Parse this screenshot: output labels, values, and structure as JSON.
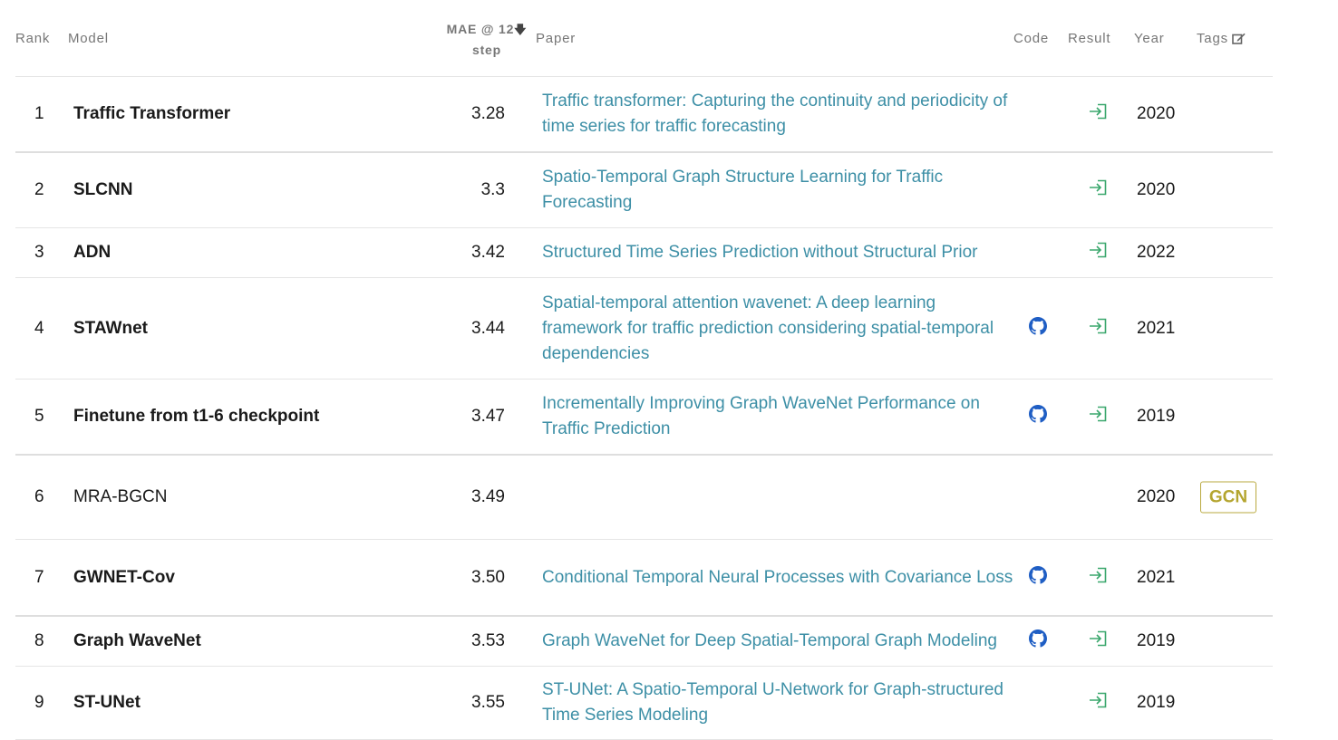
{
  "header": {
    "rank": "Rank",
    "model": "Model",
    "metric_line1": "MAE @ 12",
    "metric_line2": "step",
    "paper": "Paper",
    "code": "Code",
    "result": "Result",
    "year": "Year",
    "tags": "Tags"
  },
  "colors": {
    "link": "#3d8fa6",
    "github": "#1f5ec4",
    "result_icon": "#3aa76d",
    "tag": "#b4a52f"
  },
  "rows": [
    {
      "rank": "1",
      "model": "Traffic Transformer",
      "mae": "3.28",
      "paper": "Traffic transformer: Capturing the continuity and periodicity of time series for traffic forecasting",
      "code": false,
      "result": true,
      "year": "2020",
      "tag": ""
    },
    {
      "rank": "2",
      "model": "SLCNN",
      "mae": "3.3",
      "paper": "Spatio-Temporal Graph Structure Learning for Traffic Forecasting",
      "code": false,
      "result": true,
      "year": "2020",
      "tag": ""
    },
    {
      "rank": "3",
      "model": "ADN",
      "mae": "3.42",
      "paper": "Structured Time Series Prediction without Structural Prior",
      "code": false,
      "result": true,
      "year": "2022",
      "tag": ""
    },
    {
      "rank": "4",
      "model": "STAWnet",
      "mae": "3.44",
      "paper": "Spatial-temporal attention wavenet: A deep learning framework for traffic prediction considering spatial-temporal dependencies",
      "code": true,
      "result": true,
      "year": "2021",
      "tag": ""
    },
    {
      "rank": "5",
      "model": "Finetune from t1-6 checkpoint",
      "mae": "3.47",
      "paper": "Incrementally Improving Graph WaveNet Performance on Traffic Prediction",
      "code": true,
      "result": true,
      "year": "2019",
      "tag": ""
    },
    {
      "rank": "6",
      "model": "MRA-BGCN",
      "mae": "3.49",
      "paper": "",
      "code": false,
      "result": false,
      "year": "2020",
      "tag": "GCN"
    },
    {
      "rank": "7",
      "model": "GWNET-Cov",
      "mae": "3.50",
      "paper": "Conditional Temporal Neural Processes with Covariance Loss",
      "code": true,
      "result": true,
      "year": "2021",
      "tag": ""
    },
    {
      "rank": "8",
      "model": "Graph WaveNet",
      "mae": "3.53",
      "paper": "Graph WaveNet for Deep Spatial-Temporal Graph Modeling",
      "code": true,
      "result": true,
      "year": "2019",
      "tag": ""
    },
    {
      "rank": "9",
      "model": "ST-UNet",
      "mae": "3.55",
      "paper": "ST-UNet: A Spatio-Temporal U-Network for Graph-structured Time Series Modeling",
      "code": false,
      "result": true,
      "year": "2019",
      "tag": ""
    }
  ]
}
